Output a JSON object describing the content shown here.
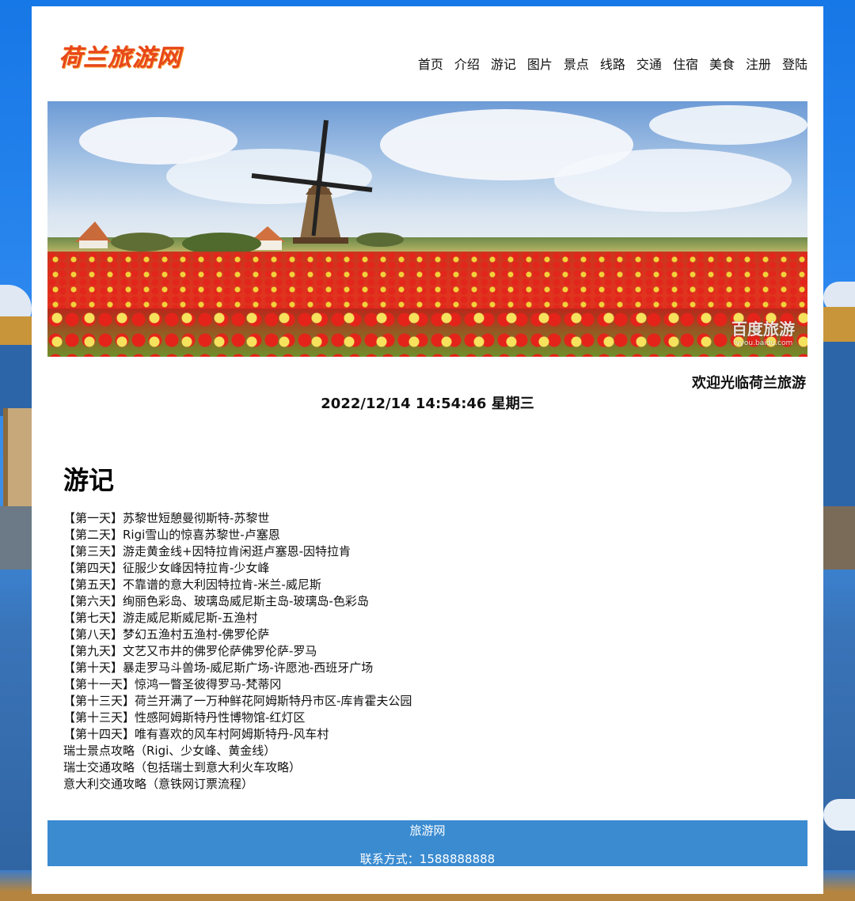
{
  "header": {
    "logo_text": "荷兰旅游网",
    "nav": [
      "首页",
      "介绍",
      "游记",
      "图片",
      "景点",
      "线路",
      "交通",
      "住宿",
      "美食",
      "注册",
      "登陆"
    ]
  },
  "banner": {
    "watermark_main": "百度旅游",
    "watermark_sub": "lvyou.baidu.com"
  },
  "marquee": "欢迎光临荷兰旅游",
  "datetime": "2022/12/14 14:54:46 星期三",
  "section": {
    "title": "游记",
    "items": [
      "【第一天】苏黎世短憩曼彻斯特-苏黎世",
      "【第二天】Rigi雪山的惊喜苏黎世-卢塞恩",
      "【第三天】游走黄金线+因特拉肯闲逛卢塞恩-因特拉肯",
      "【第四天】征服少女峰因特拉肯-少女峰",
      "【第五天】不靠谱的意大利因特拉肯-米兰-威尼斯",
      "【第六天】绚丽色彩岛、玻璃岛威尼斯主岛-玻璃岛-色彩岛",
      "【第七天】游走威尼斯威尼斯-五渔村",
      "【第八天】梦幻五渔村五渔村-佛罗伦萨",
      "【第九天】文艺又市井的佛罗伦萨佛罗伦萨-罗马",
      "【第十天】暴走罗马斗兽场-威尼斯广场-许愿池-西班牙广场",
      "【第十一天】惊鸿一瞥圣彼得罗马-梵蒂冈",
      "【第十三天】荷兰开满了一万种鲜花阿姆斯特丹市区-库肯霍夫公园",
      "【第十三天】性感阿姆斯特丹性博物馆-红灯区",
      "【第十四天】唯有喜欢的风车村阿姆斯特丹-风车村",
      "瑞士景点攻略（Rigi、少女峰、黄金线）",
      "瑞士交通攻略（包括瑞士到意大利火车攻略）",
      "意大利交通攻略（意铁网订票流程）"
    ]
  },
  "footer": {
    "site_name": "旅游网",
    "contact": "联系方式：1588888888"
  },
  "colors": {
    "logo": "#e8461b",
    "footer_bg": "#3a8bd0",
    "page_bg": "#1677e6"
  }
}
